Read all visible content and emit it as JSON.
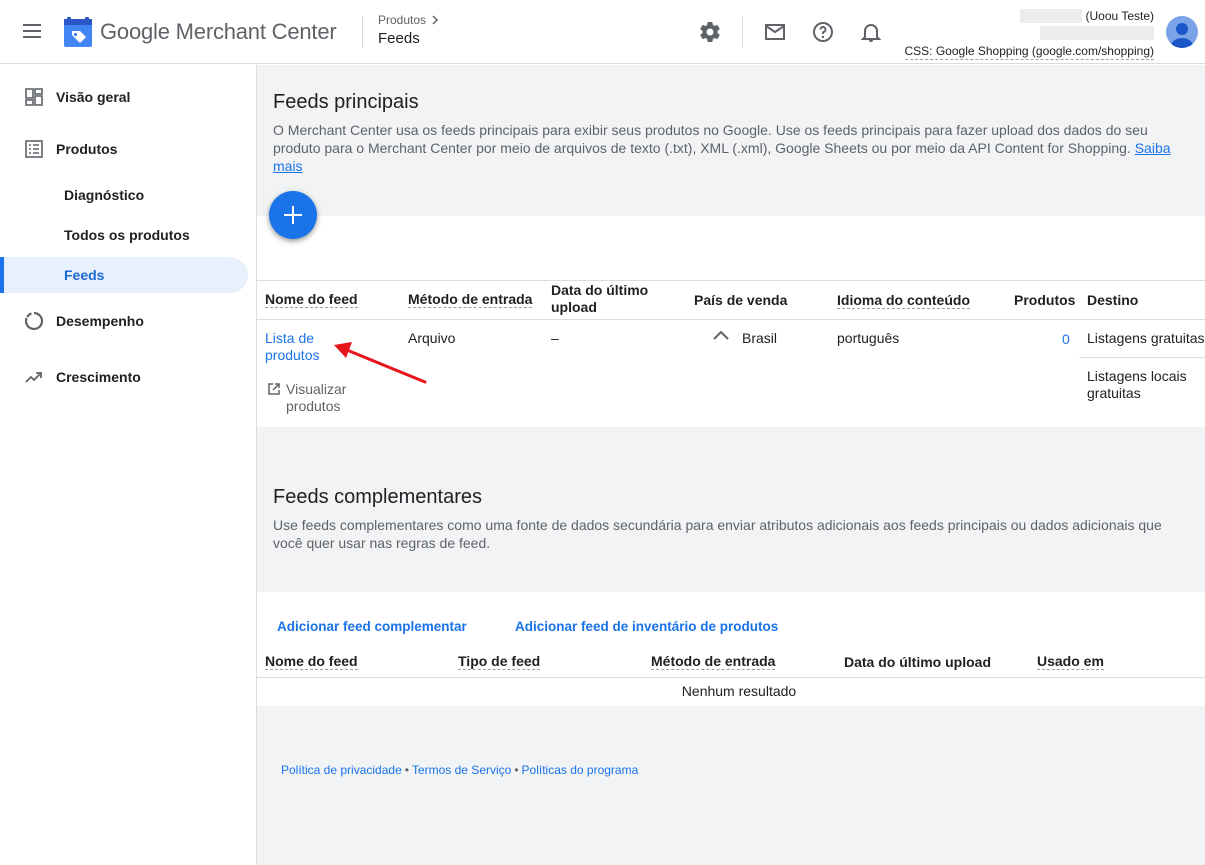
{
  "header": {
    "app_name": "Google Merchant Center",
    "breadcrumb_parent": "Produtos",
    "breadcrumb_current": "Feeds",
    "account_name": "(Uoou Teste)",
    "css_label": "CSS: Google Shopping (google.com/shopping)"
  },
  "sidebar": {
    "items": [
      {
        "label": "Visão geral"
      },
      {
        "label": "Produtos"
      },
      {
        "label": "Diagnóstico"
      },
      {
        "label": "Todos os produtos"
      },
      {
        "label": "Feeds"
      },
      {
        "label": "Desempenho"
      },
      {
        "label": "Crescimento"
      }
    ]
  },
  "primary": {
    "title": "Feeds principais",
    "description": "O Merchant Center usa os feeds principais para exibir seus produtos no Google. Use os feeds principais para fazer upload dos dados do seu produto para o Merchant Center por meio de arquivos de texto (.txt), XML (.xml), Google Sheets ou por meio da API Content for Shopping.",
    "learn_more": "Saiba mais",
    "columns": [
      "Nome do feed",
      "Método de entrada",
      "Data do último upload",
      "País de venda",
      "Idioma do conteúdo",
      "Produtos",
      "Destino"
    ],
    "row": {
      "feed_name": "Lista de produtos",
      "view_products": "Visualizar produtos",
      "input_method": "Arquivo",
      "last_upload": "–",
      "country": "Brasil",
      "language": "português",
      "products": "0",
      "destination_1": "Listagens gratuitas",
      "destination_2": "Listagens locais gratuitas"
    }
  },
  "supplemental": {
    "title": "Feeds complementares",
    "description": "Use feeds complementares como uma fonte de dados secundária para enviar atributos adicionais aos feeds principais ou dados adicionais que você quer usar nas regras de feed.",
    "add_supplemental": "Adicionar feed complementar",
    "add_inventory": "Adicionar feed de inventário de produtos",
    "columns": [
      "Nome do feed",
      "Tipo de feed",
      "Método de entrada",
      "Data do último upload",
      "Usado em"
    ],
    "empty": "Nenhum resultado"
  },
  "footer": {
    "privacy": "Política de privacidade",
    "terms": "Termos de Serviço",
    "policies": "Políticas do programa",
    "separator": "•"
  },
  "colors": {
    "accent": "#1a73e8",
    "annotation_arrow": "#e8141b"
  }
}
